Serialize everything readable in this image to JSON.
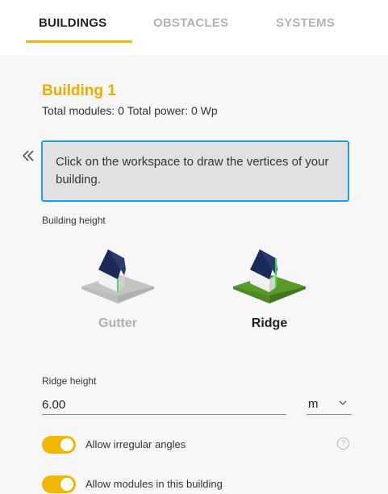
{
  "tabs": [
    {
      "label": "BUILDINGS",
      "active": true
    },
    {
      "label": "OBSTACLES",
      "active": false
    },
    {
      "label": "SYSTEMS",
      "active": false
    }
  ],
  "building": {
    "title": "Building 1",
    "modules_label": "Total modules: ",
    "modules_value": "0",
    "power_label": " Total power: ",
    "power_value": "0 Wp"
  },
  "instruction": "Click on the workspace to draw the vertices of your building.",
  "building_height": {
    "label": "Building height",
    "options": [
      {
        "label": "Gutter",
        "selected": false
      },
      {
        "label": "Ridge",
        "selected": true
      }
    ]
  },
  "ridge_height": {
    "label": "Ridge height",
    "value": "6.00",
    "unit": "m"
  },
  "toggles": [
    {
      "label": "Allow irregular angles",
      "on": true
    },
    {
      "label": "Allow modules in this building",
      "on": true
    }
  ],
  "colors": {
    "accent": "#f2b705",
    "title": "#f2a900",
    "info_border": "#1ba0e8",
    "roof": "#1c2a5a",
    "edge_highlight": "#2ee84a",
    "ground_active": "#5a9a2b"
  },
  "icons": {
    "collapse": "double-chevron-left-icon",
    "help": "question-circle-icon",
    "unit_dropdown": "chevron-down-icon"
  }
}
